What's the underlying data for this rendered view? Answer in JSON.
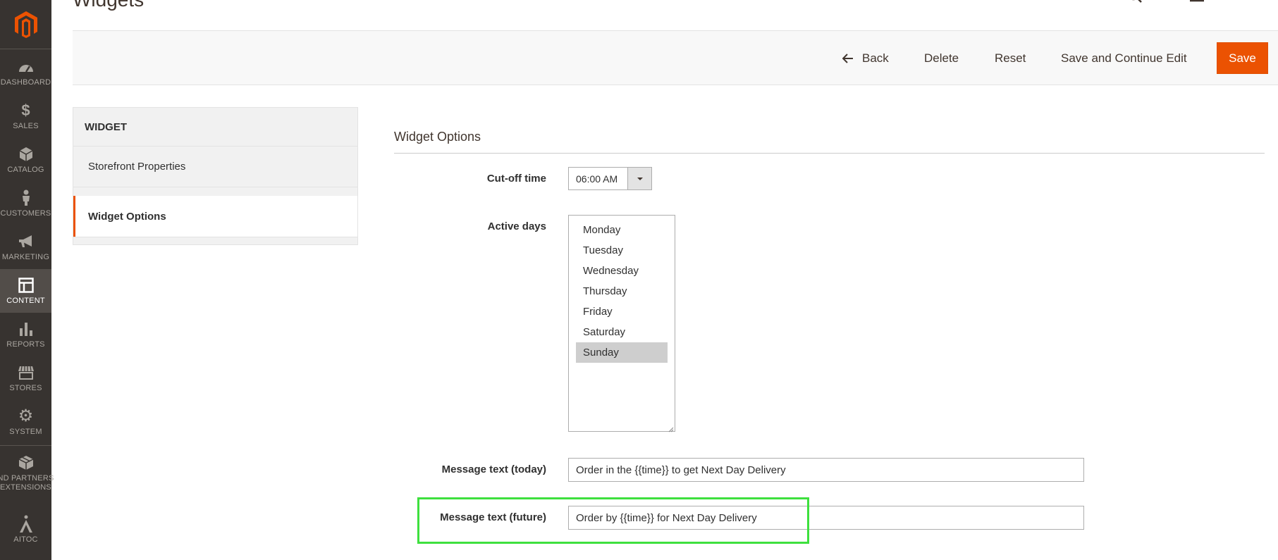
{
  "page": {
    "title": "Widgets"
  },
  "sidebar": {
    "items": [
      {
        "label": "DASHBOARD",
        "icon": "speedometer-icon"
      },
      {
        "label": "SALES",
        "icon": "dollar-icon"
      },
      {
        "label": "CATALOG",
        "icon": "cube-icon"
      },
      {
        "label": "CUSTOMERS",
        "icon": "person-icon"
      },
      {
        "label": "MARKETING",
        "icon": "megaphone-icon"
      },
      {
        "label": "CONTENT",
        "icon": "layout-icon",
        "active": true
      },
      {
        "label": "REPORTS",
        "icon": "bar-chart-icon"
      },
      {
        "label": "STORES",
        "icon": "storefront-icon"
      },
      {
        "label": "SYSTEM",
        "icon": "gear-icon"
      },
      {
        "label": "ND PARTNERS EXTENSIONS",
        "icon": "box-icon"
      },
      {
        "label": "AITOC",
        "icon": "aitoc-icon"
      }
    ]
  },
  "actions": {
    "back_label": "Back",
    "delete_label": "Delete",
    "reset_label": "Reset",
    "save_continue_label": "Save and Continue Edit",
    "save_label": "Save"
  },
  "left_panel": {
    "title": "WIDGET",
    "items": [
      {
        "label": "Storefront Properties"
      },
      {
        "label": "Widget Options",
        "active": true
      }
    ]
  },
  "form": {
    "section_title": "Widget Options",
    "cutoff": {
      "label": "Cut-off time",
      "value": "06:00 AM"
    },
    "active_days": {
      "label": "Active days",
      "options": [
        "Monday",
        "Tuesday",
        "Wednesday",
        "Thursday",
        "Friday",
        "Saturday",
        "Sunday"
      ],
      "selected": [
        "Sunday"
      ]
    },
    "message_today": {
      "label": "Message text (today)",
      "value": "Order in the {{time}} to get Next Day Delivery"
    },
    "message_future": {
      "label": "Message text (future)",
      "value": "Order by {{time}} for Next Day Delivery"
    }
  },
  "colors": {
    "brand_orange": "#eb5202",
    "sidebar_bg": "#373330",
    "highlight_green": "#3ee03e"
  }
}
